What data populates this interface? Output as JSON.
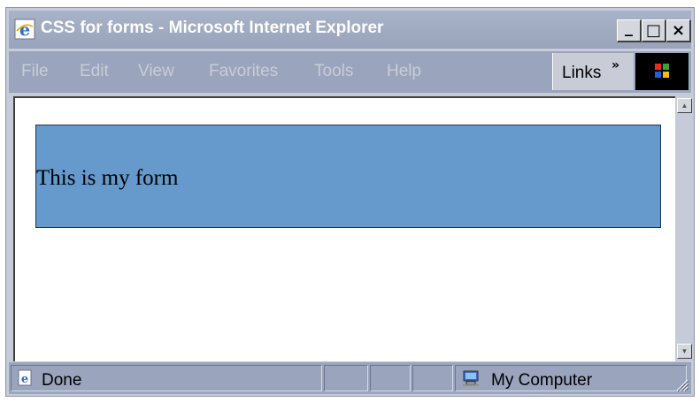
{
  "window": {
    "title": "CSS for forms - Microsoft Internet Explorer",
    "controls": {
      "minimize": "_",
      "maximize": "□",
      "close": "×"
    }
  },
  "menu": {
    "items": [
      "File",
      "Edit",
      "View",
      "Favorites",
      "Tools",
      "Help"
    ],
    "links_label": "Links",
    "links_chevron": "»"
  },
  "content": {
    "form_text": "This is my form",
    "form_bg_color": "#6699cc"
  },
  "status": {
    "text": "Done",
    "zone": "My Computer"
  },
  "icons": {
    "app": "ie-icon",
    "throbber": "windows-logo-icon",
    "status": "ie-page-icon",
    "zone": "my-computer-icon"
  }
}
